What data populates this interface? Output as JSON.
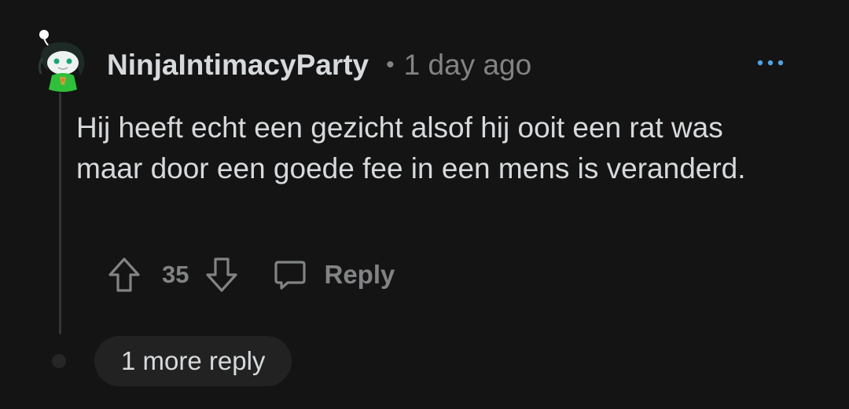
{
  "comment": {
    "author": "NinjaIntimacyParty",
    "separator": "•",
    "timestamp": "1 day ago",
    "body": "Hij heeft echt een gezicht alsof hij ooit een rat was maar door een goede fee in een mens is veranderd.",
    "score": "35",
    "reply_label": "Reply",
    "more_replies_label": "1 more reply",
    "icons": {
      "avatar": "snoo-avatar-icon",
      "more": "more-options-icon",
      "upvote": "upvote-arrow-icon",
      "downvote": "downvote-arrow-icon",
      "reply": "reply-bubble-icon"
    }
  },
  "colors": {
    "background": "#141414",
    "text_primary": "#d7dadc",
    "text_secondary": "#818384",
    "accent_more": "#4fa3e0",
    "pill_background": "#222223",
    "avatar_green": "#2fbf3a"
  }
}
